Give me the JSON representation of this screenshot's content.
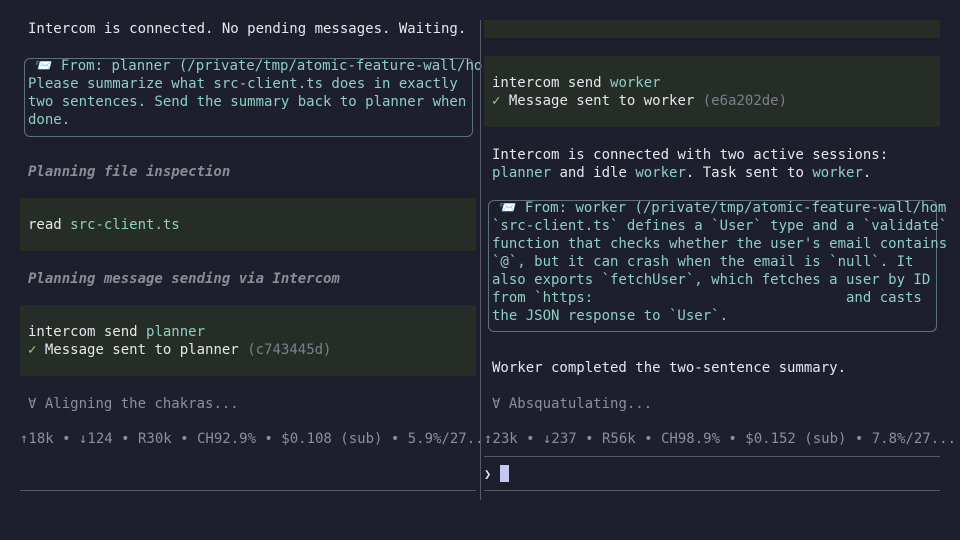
{
  "left": {
    "status_line": "Intercom is connected. No pending messages. Waiting.",
    "message": {
      "icon": "📨",
      "from": "From: planner (/private/tmp/atomic-feature-wall/ho",
      "lines": [
        "Please summarize what src-client.ts does in exactly",
        "two sentences. Send the summary back to planner when",
        "done."
      ]
    },
    "planning_1": "Planning file inspection",
    "read_cmd": "read",
    "read_arg": "src-client.ts",
    "planning_2": "Planning message sending via Intercom",
    "send_cmd": "intercom send",
    "send_target": "planner",
    "sent_check": "✓",
    "sent_text": "Message sent to planner",
    "sent_id": "(c743445d)",
    "spinner_glyph": "∀",
    "spinner_text": "Aligning the chakras...",
    "stats": "↑18k • ↓124 • R30k • CH92.9% • $0.108 (sub) • 5.9%/27..."
  },
  "right": {
    "send_cmd": "intercom send",
    "send_target": "worker",
    "sent_check": "✓",
    "sent_text": "Message sent to worker",
    "sent_id": "(e6a202de)",
    "connected_line1": "Intercom is connected with two active sessions:",
    "connected_line2_a": "planner",
    "connected_line2_b": " and idle ",
    "connected_line2_c": "worker",
    "connected_line2_d": ". Task sent to ",
    "connected_line2_e": "worker",
    "connected_line2_f": ".",
    "message": {
      "icon": "📨",
      "from": "From: worker (/private/tmp/atomic-feature-wall/hom",
      "lines": [
        "`src-client.ts` defines a `User` type and a `validate`",
        "function that checks whether the user's email contains",
        "`@`, but it can crash when the email is `null`. It",
        "also exports `fetchUser`, which fetches a user by ID",
        "from `https:                              and casts",
        "the JSON response to `User`."
      ]
    },
    "completed": "Worker completed the two-sentence summary.",
    "spinner_glyph": "∀",
    "spinner_text": "Absquatulating...",
    "stats": "↑23k • ↓237 • R56k • CH98.9% • $0.152 (sub) • 7.8%/27...",
    "prompt": "❯"
  }
}
